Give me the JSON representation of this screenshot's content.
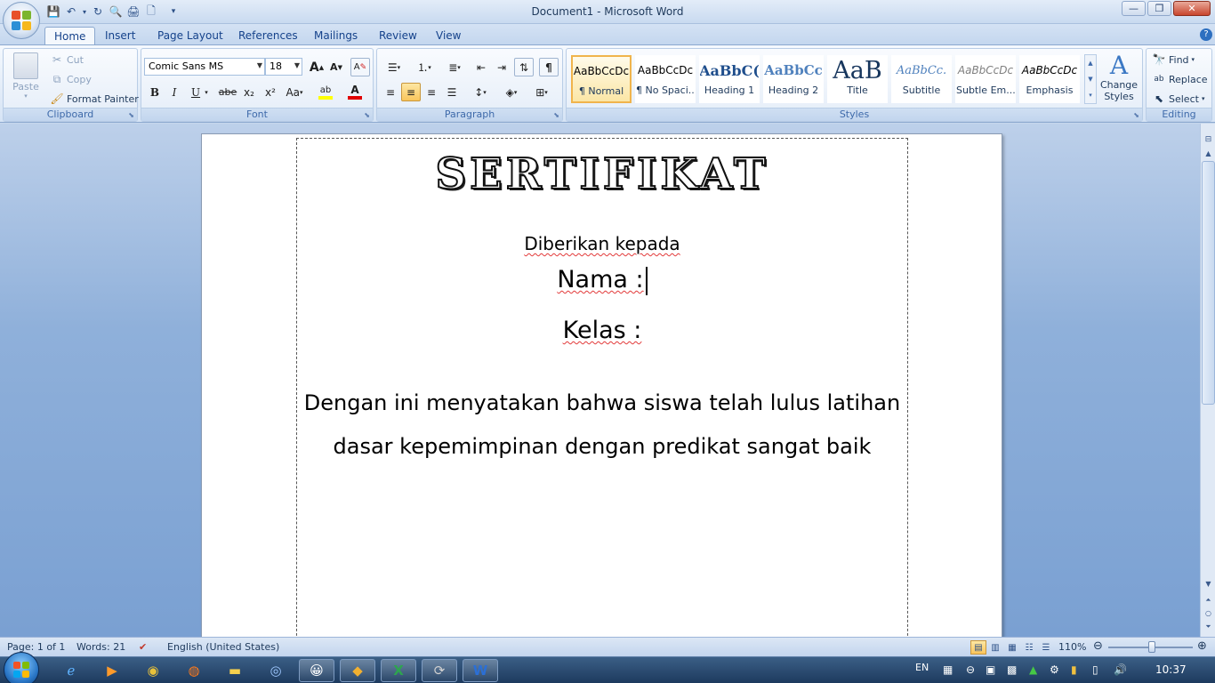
{
  "window": {
    "title": "Document1 - Microsoft Word",
    "minimize": "—",
    "maximize": "❐",
    "close": "✕"
  },
  "qat": [
    {
      "name": "save-icon",
      "glyph": "💾"
    },
    {
      "name": "undo-icon",
      "glyph": "↶"
    },
    {
      "name": "redo-icon",
      "glyph": "↻"
    },
    {
      "name": "print-preview-icon",
      "glyph": "🔍"
    },
    {
      "name": "print-icon",
      "glyph": "🖨"
    },
    {
      "name": "new-document-icon",
      "glyph": "🗋"
    },
    {
      "name": "customize-qat-icon",
      "glyph": "▾"
    }
  ],
  "tabs": [
    "Home",
    "Insert",
    "Page Layout",
    "References",
    "Mailings",
    "Review",
    "View"
  ],
  "active_tab": "Home",
  "help_icon": "?",
  "clipboard": {
    "label": "Clipboard",
    "paste": "Paste",
    "cut": "Cut",
    "copy": "Copy",
    "format_painter": "Format Painter"
  },
  "font": {
    "label": "Font",
    "family": "Comic Sans MS",
    "size": "18",
    "grow": "A",
    "shrink": "A",
    "clear": "A",
    "bold": "B",
    "italic": "I",
    "underline": "U",
    "strikethrough": "abe",
    "subscript": "x₂",
    "superscript": "x²",
    "change_case": "Aa",
    "highlight": "ab",
    "font_color": "A"
  },
  "paragraph": {
    "label": "Paragraph",
    "show_marks": "¶"
  },
  "styles": {
    "label": "Styles",
    "items": [
      {
        "sample": "AaBbCcDc",
        "name": "¶ Normal"
      },
      {
        "sample": "AaBbCcDc",
        "name": "¶ No Spaci..."
      },
      {
        "sample": "AaBbC(",
        "name": "Heading 1"
      },
      {
        "sample": "AaBbCc",
        "name": "Heading 2"
      },
      {
        "sample": "AaB",
        "name": "Title"
      },
      {
        "sample": "AaBbCc.",
        "name": "Subtitle"
      },
      {
        "sample": "AaBbCcDc",
        "name": "Subtle Em..."
      },
      {
        "sample": "AaBbCcDc",
        "name": "Emphasis"
      }
    ],
    "change_styles": "Change Styles"
  },
  "editing": {
    "label": "Editing",
    "find": "Find",
    "replace": "Replace",
    "select": "Select"
  },
  "document": {
    "title": "SERTIFIKAT",
    "given_to": "Diberikan kepada",
    "name_label": "Nama :",
    "class_label": "Kelas :",
    "body_line1": "Dengan ini menyatakan bahwa siswa telah lulus latihan",
    "body_line2": "dasar kepemimpinan dengan predikat sangat baik"
  },
  "status": {
    "page": "Page: 1 of 1",
    "words": "Words: 21",
    "language": "English (United States)",
    "zoom": "110%",
    "zoom_fraction": 0.52
  },
  "taskbar": {
    "lang": "EN",
    "clock": "10:37"
  },
  "colors": {
    "accent": "#15428b",
    "highlight_yellow": "#ffff00",
    "font_red": "#e00000"
  }
}
